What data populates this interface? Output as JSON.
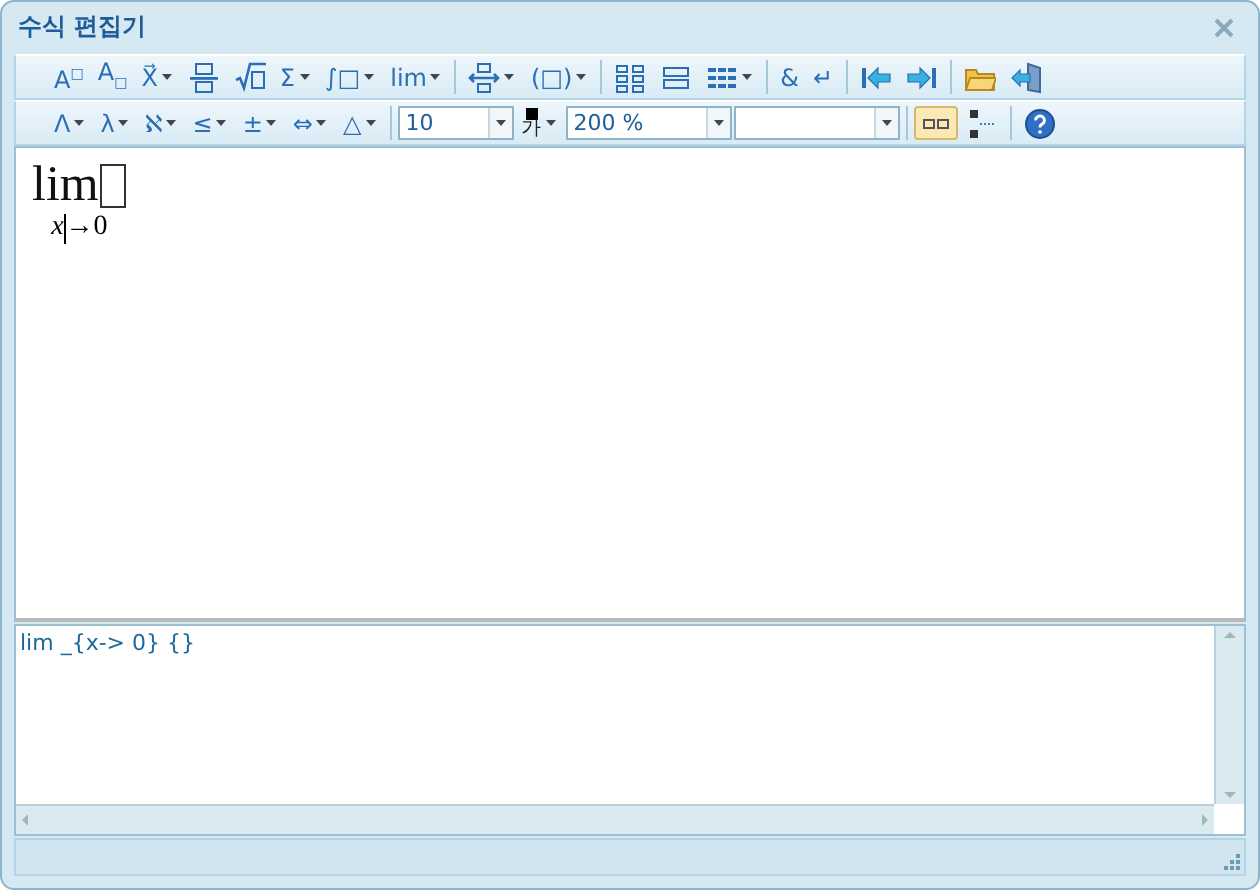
{
  "window": {
    "title": "수식 편집기"
  },
  "toolbars": [
    {
      "items": [
        {
          "kind": "glyph",
          "text": "A$^{□}$",
          "dropdown": false
        },
        {
          "kind": "glyph",
          "text": "A$_{□}$",
          "dropdown": false
        },
        {
          "kind": "glyph",
          "text": "X⃗",
          "dropdown": true
        },
        {
          "kind": "icon",
          "dropdown": false
        },
        {
          "kind": "icon",
          "dropdown": false
        },
        {
          "kind": "glyph",
          "text": "Σ",
          "dropdown": true
        },
        {
          "kind": "glyph",
          "text": "∫□",
          "dropdown": true
        },
        {
          "kind": "glyph",
          "text": "lim",
          "dropdown": true
        },
        {
          "kind": "sep"
        },
        {
          "kind": "icon",
          "dropdown": true
        },
        {
          "kind": "glyph",
          "text": "(□)",
          "dropdown": true
        },
        {
          "kind": "sep"
        },
        {
          "kind": "icon",
          "dropdown": false
        },
        {
          "kind": "icon",
          "dropdown": false
        },
        {
          "kind": "icon",
          "dropdown": true
        },
        {
          "kind": "sep"
        },
        {
          "kind": "glyph",
          "text": "&",
          "dropdown": false
        },
        {
          "kind": "glyph",
          "text": "↵",
          "dropdown": false
        },
        {
          "kind": "sep"
        },
        {
          "kind": "icon",
          "dropdown": false
        },
        {
          "kind": "icon",
          "dropdown": false
        },
        {
          "kind": "sep"
        },
        {
          "kind": "icon",
          "dropdown": false
        },
        {
          "kind": "icon",
          "dropdown": false
        }
      ]
    },
    {
      "items": [
        {
          "kind": "glyph",
          "text": "Λ",
          "dropdown": true
        },
        {
          "kind": "glyph",
          "text": "λ",
          "dropdown": true
        },
        {
          "kind": "glyph",
          "text": "ℵ",
          "dropdown": true
        },
        {
          "kind": "glyph",
          "text": "≤",
          "dropdown": true
        },
        {
          "kind": "glyph",
          "text": "±",
          "dropdown": true
        },
        {
          "kind": "glyph",
          "text": "⇔",
          "dropdown": true
        },
        {
          "kind": "glyph",
          "text": "△",
          "dropdown": true
        },
        {
          "kind": "sep"
        },
        {
          "kind": "combo",
          "value": "10",
          "wide": false
        },
        {
          "kind": "color",
          "text": "가",
          "dropdown": true
        },
        {
          "kind": "combo",
          "value": "200 %",
          "wide": true
        },
        {
          "kind": "combo",
          "value": "",
          "wide": true
        },
        {
          "kind": "sep"
        },
        {
          "kind": "toggle",
          "selected": true
        },
        {
          "kind": "toggle",
          "selected": false
        },
        {
          "kind": "sep"
        },
        {
          "kind": "icon",
          "dropdown": false
        }
      ]
    }
  ],
  "editor": {
    "operator": "lim",
    "subscript_before_cursor": "x",
    "subscript_after_cursor": "→0"
  },
  "source": {
    "text": "lim _{x-> 0} {}"
  }
}
